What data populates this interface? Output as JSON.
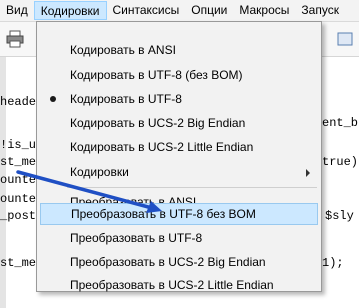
{
  "menubar": {
    "items": [
      {
        "label": "Вид"
      },
      {
        "label": "Кодировки"
      },
      {
        "label": "Синтаксисы"
      },
      {
        "label": "Опции"
      },
      {
        "label": "Макросы"
      },
      {
        "label": "Запуск"
      }
    ]
  },
  "editor": {
    "lines": [
      "heade",
      "!is_u",
      "st_me",
      "ounte",
      "ounte",
      "_post",
      "st_me"
    ],
    "right_fragments": [
      "ent_b",
      "true)",
      "$sly",
      "1);"
    ]
  },
  "menu": {
    "items": [
      {
        "label": "Кодировать в ANSI"
      },
      {
        "label": "Кодировать в UTF-8 (без BOM)"
      },
      {
        "label": "Кодировать в UTF-8",
        "checked": true
      },
      {
        "label": "Кодировать в UCS-2 Big Endian"
      },
      {
        "label": "Кодировать в UCS-2 Little Endian"
      },
      {
        "label": "Кодировки",
        "submenu": true
      },
      {
        "label": "Преобразовать в ANSI"
      },
      {
        "label": "Преобразовать в UTF-8 без BOM",
        "highlighted": true
      },
      {
        "label": "Преобразовать в UTF-8"
      },
      {
        "label": "Преобразовать в UCS-2 Big Endian"
      },
      {
        "label": "Преобразовать в UCS-2 Little Endian"
      }
    ]
  },
  "colors": {
    "highlight_bg": "#cce8ff",
    "arrow": "#1f4fc4"
  }
}
